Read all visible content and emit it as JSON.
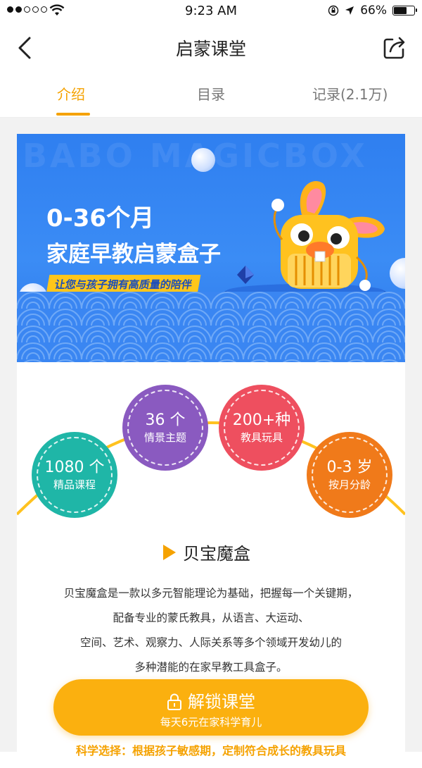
{
  "status_bar": {
    "time": "9:23 AM",
    "battery": "66%",
    "battery_level": 0.66
  },
  "nav": {
    "title": "启蒙课堂"
  },
  "tabs": [
    {
      "label": "介绍",
      "active": true
    },
    {
      "label": "目录",
      "active": false
    },
    {
      "label": "记录(2.1万)",
      "active": false
    }
  ],
  "banner": {
    "watermark": "BABO MAGICBOX",
    "headline_1": "0-36个月",
    "headline_2": "家庭早教启蒙盒子",
    "tagline": "让您与孩子拥有高质量的陪伴"
  },
  "stats": [
    {
      "value": "1080 个",
      "label": "精品课程",
      "color": "#1fb6a7"
    },
    {
      "value": "36 个",
      "label": "情景主题",
      "color": "#8a5ac0"
    },
    {
      "value": "200+种",
      "label": "教具玩具",
      "color": "#ee4f5f"
    },
    {
      "value": "0-3 岁",
      "label": "按月分龄",
      "color": "#f07a1a"
    }
  ],
  "section": {
    "title": "贝宝魔盒",
    "description_lines": [
      "贝宝魔盒是一款以多元智能理论为基础，把握每一个关键期，",
      "配备专业的蒙氏教具，从语言、大运动、",
      "空间、艺术、观察力、人际关系等多个领域开发幼儿的",
      "多种潜能的在家早教工具盒子。"
    ]
  },
  "cta": {
    "label": "解锁课堂",
    "sub": "每天6元在家科学育儿"
  },
  "bottom_text": "科学选择：根据孩子敏感期，定制符合成长的教具玩具",
  "colors": {
    "accent": "#f5a200",
    "banner_blue": "#2f7ff0"
  }
}
